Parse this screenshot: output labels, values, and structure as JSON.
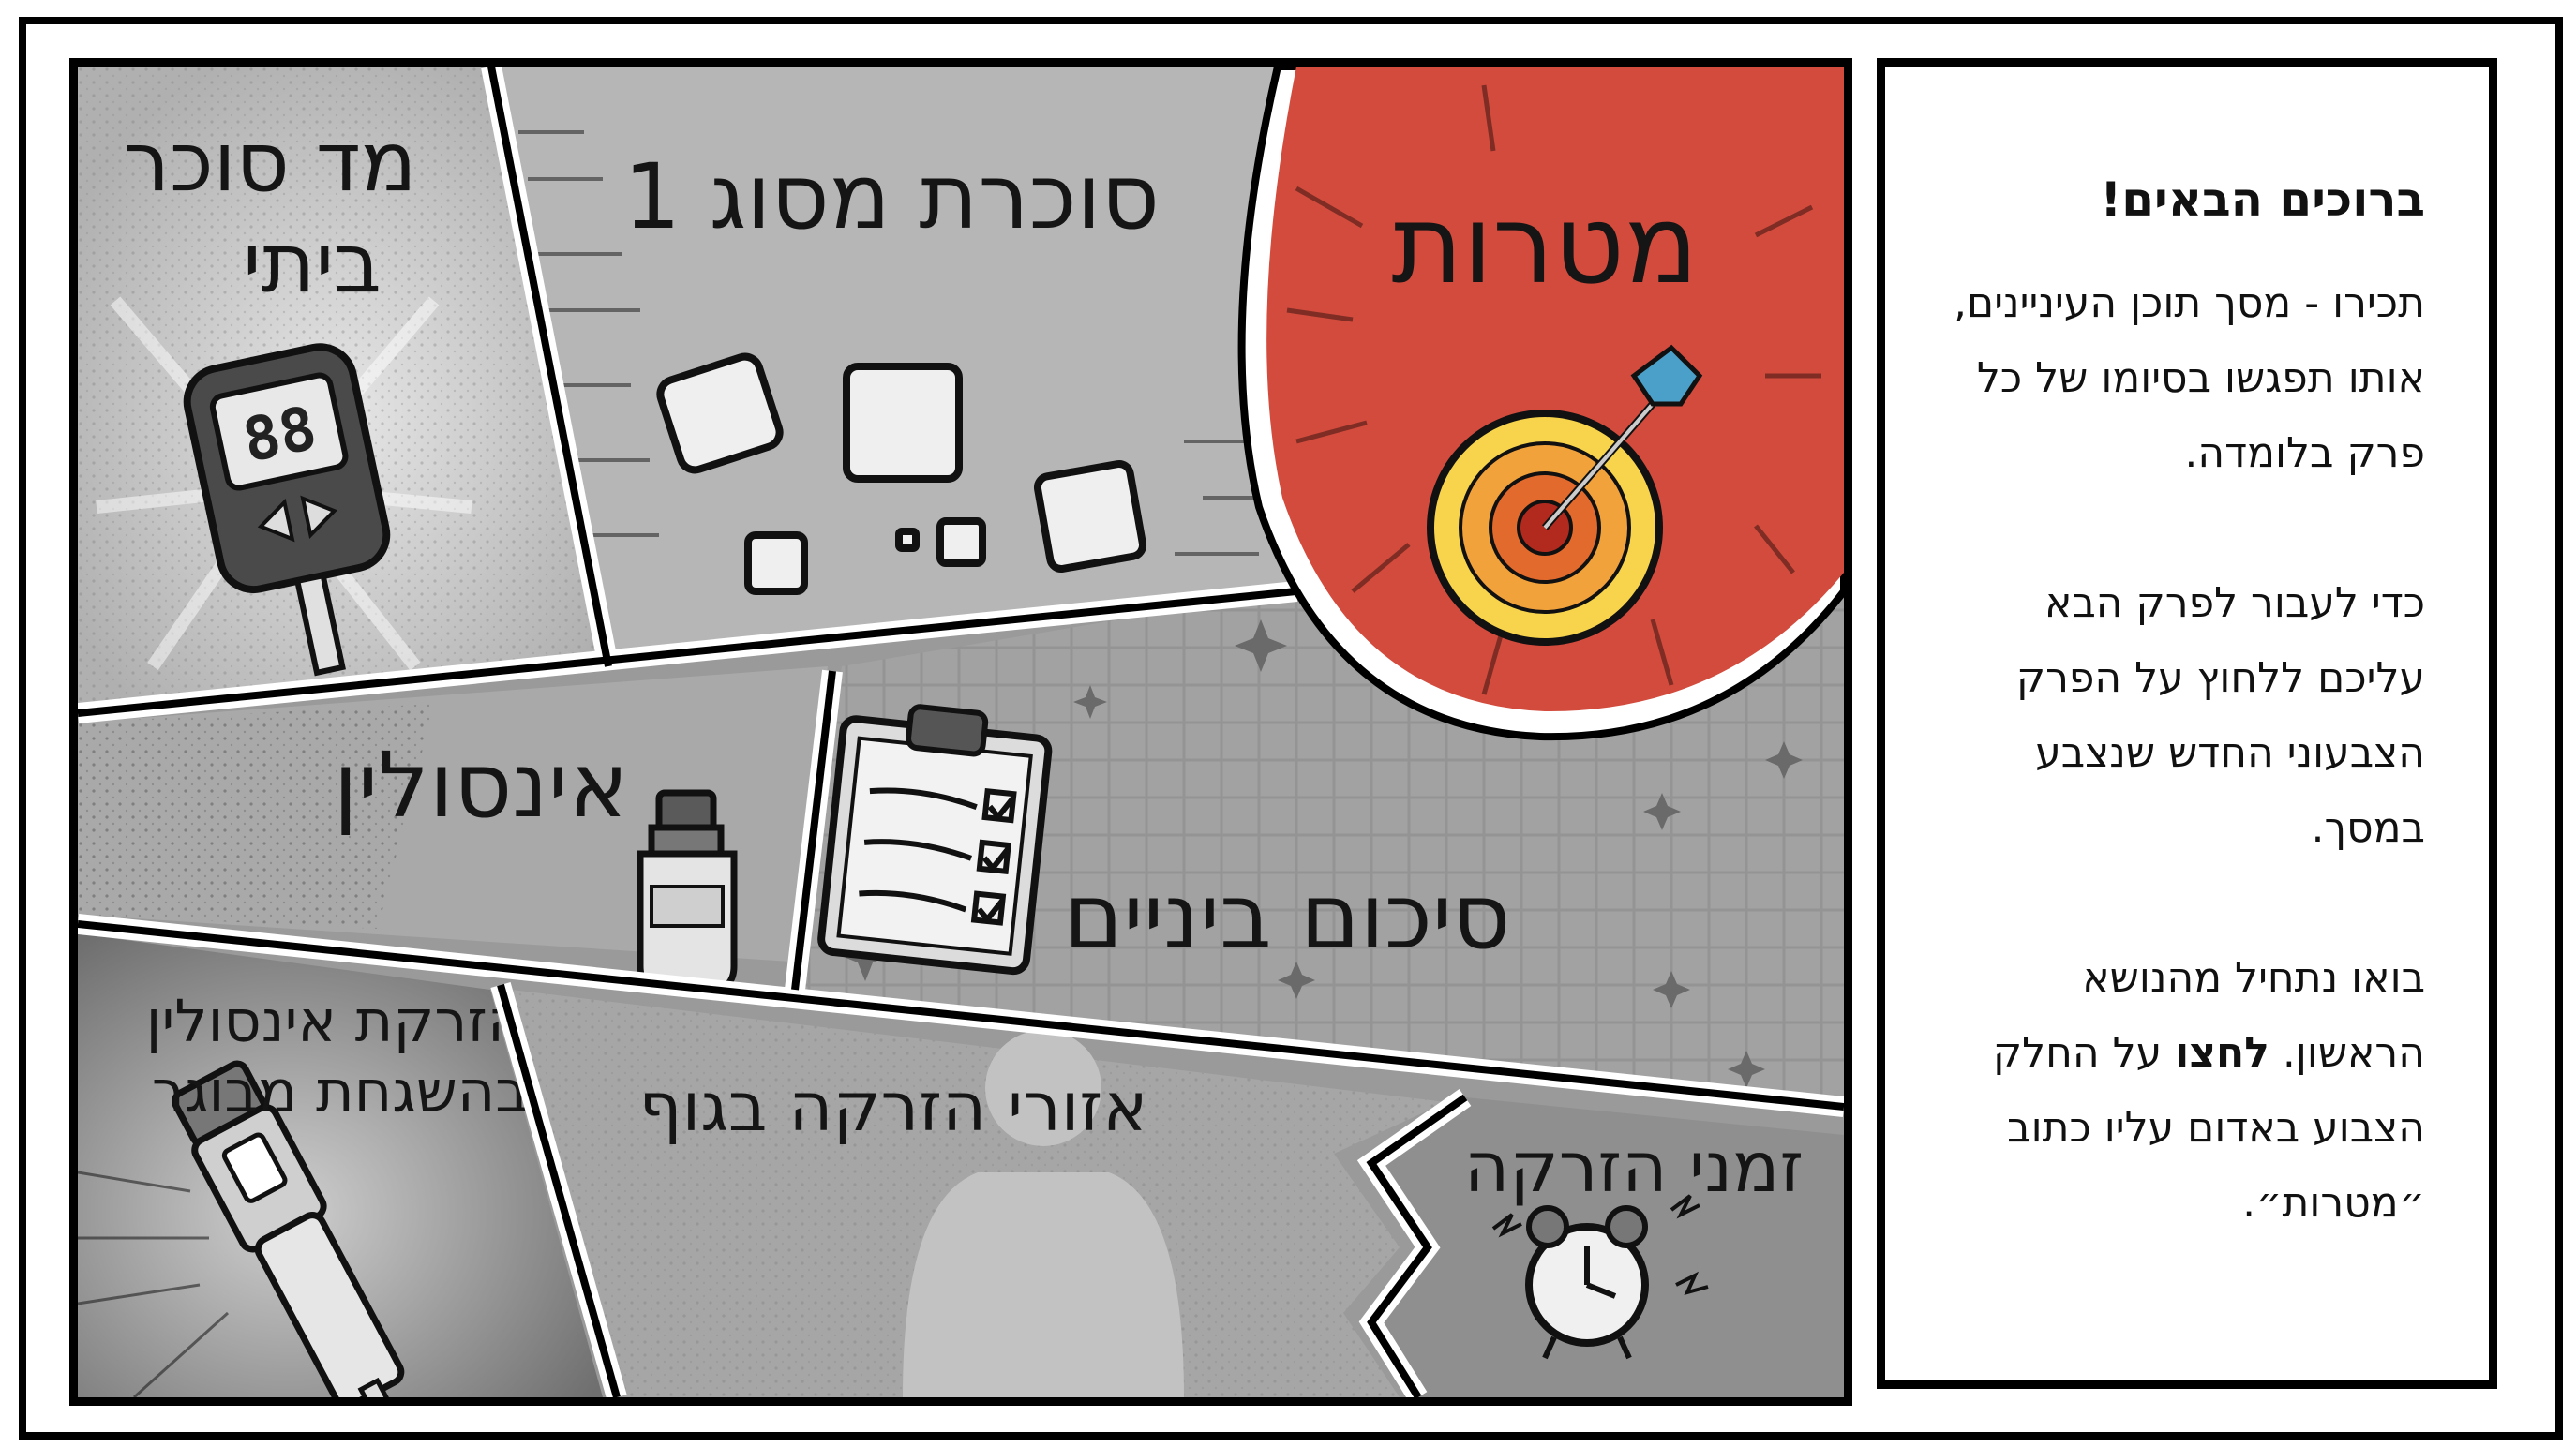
{
  "comic": {
    "panels": {
      "glucometer": {
        "title_line1": "מד סוכר",
        "title_line2": "ביתי",
        "display": "88"
      },
      "diabetes_type1": {
        "title": "סוכרת מסוג 1"
      },
      "goals": {
        "title": "מטרות"
      },
      "insulin": {
        "title": "אינסולין"
      },
      "interim_summary": {
        "title": "סיכום ביניים"
      },
      "supervised_injection": {
        "title_line1": "הזרקת אינסולין",
        "title_line2": "בהשגחת מבוגר"
      },
      "injection_areas": {
        "title": "אזורי הזרקה בגוף"
      },
      "injection_times": {
        "title": "זמני הזרקה"
      }
    }
  },
  "info": {
    "heading": "ברוכים הבאים!",
    "para1": "תכירו - מסך תוכן העיניינים, אותו תפגשו בסיומו של כל פרק בלומדה.",
    "para2": "כדי לעבור לפרק הבא עליכם ללחוץ על הפרק הצבעוני החדש שנצבע במסך.",
    "para3_before": "בואו נתחיל מהנושא הראשון.",
    "para3_bold": "לחצו",
    "para3_after": "על החלק הצבוע באדום עליו כתוב ״מטרות״."
  },
  "colors": {
    "goals_red": "#d24b3d",
    "panel_gray_light": "#c4c4c4",
    "panel_gray_mid": "#a8a8a8",
    "panel_gray_dark": "#8a8a8a",
    "ink": "#111111"
  }
}
